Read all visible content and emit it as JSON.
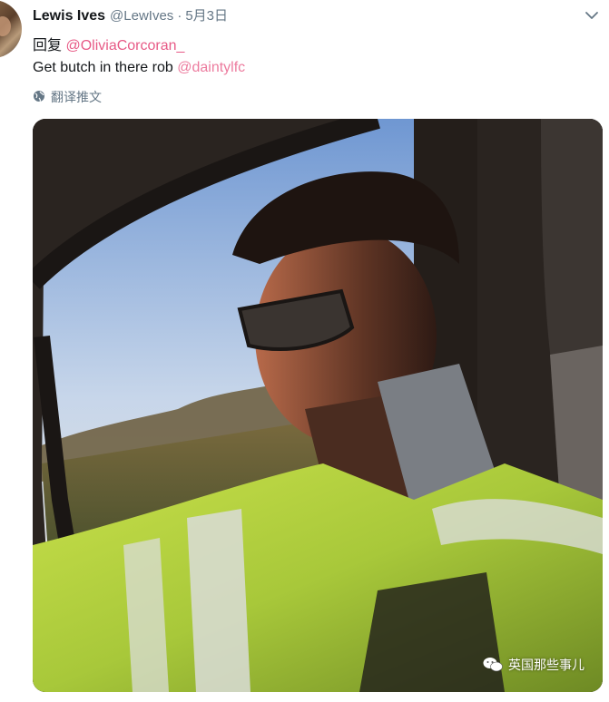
{
  "tweet": {
    "author_name": "Lewis Ives",
    "author_handle": "@LewIves",
    "separator": "·",
    "date": "5月3日",
    "reply_prefix": "回复",
    "reply_to": "@OliviaCorcoran_",
    "text": "Get butch in there rob",
    "text_mention": "@daintylfc",
    "translate_label": "翻译推文"
  },
  "watermark": {
    "label": "英国那些事儿"
  },
  "icons": {
    "menu": "chevron-down-icon",
    "translate": "globe-icon",
    "watermark": "wechat-icon"
  },
  "colors": {
    "name": "#14171a",
    "secondary": "#657786",
    "mention": "#e0245e"
  }
}
